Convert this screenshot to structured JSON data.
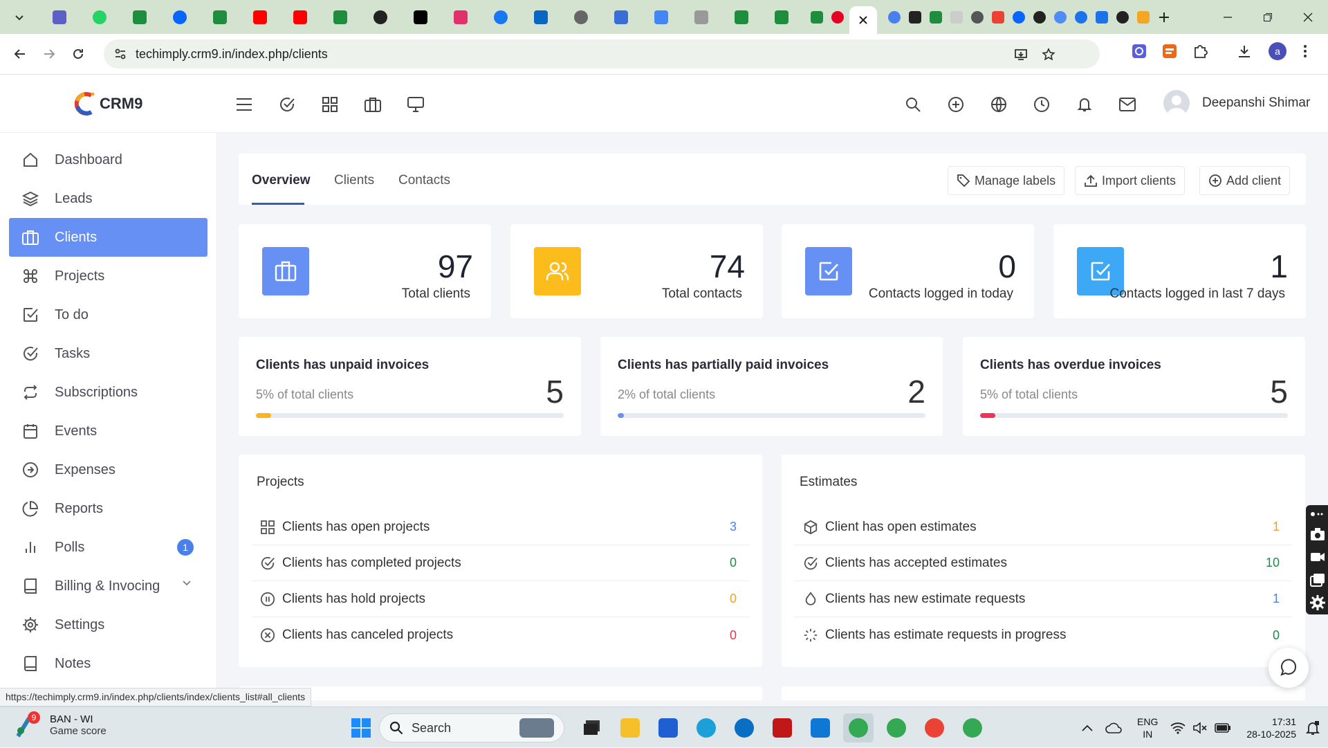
{
  "browser": {
    "url": "techimply.crm9.in/index.php/clients",
    "status_url": "https://techimply.crm9.in/index.php/clients/index/clients_list#all_clients",
    "profile_initial": "a"
  },
  "app": {
    "logo_text": "CRM9",
    "user_name": "Deepanshi Shimar"
  },
  "sidebar": {
    "items": [
      {
        "label": "Dashboard"
      },
      {
        "label": "Leads"
      },
      {
        "label": "Clients"
      },
      {
        "label": "Projects"
      },
      {
        "label": "To do"
      },
      {
        "label": "Tasks"
      },
      {
        "label": "Subscriptions"
      },
      {
        "label": "Events"
      },
      {
        "label": "Expenses"
      },
      {
        "label": "Reports"
      },
      {
        "label": "Polls",
        "badge": "1"
      },
      {
        "label": "Billing & Invocing"
      },
      {
        "label": "Settings"
      },
      {
        "label": "Notes"
      }
    ]
  },
  "page": {
    "tabs": [
      "Overview",
      "Clients",
      "Contacts"
    ],
    "actions": {
      "manage_labels": "Manage labels",
      "import_clients": "Import clients",
      "add_client": "Add client"
    }
  },
  "stats": [
    {
      "value": "97",
      "label": "Total clients",
      "color": "#6690f4"
    },
    {
      "value": "74",
      "label": "Total contacts",
      "color": "#fbbc1c"
    },
    {
      "value": "0",
      "label": "Contacts logged in today",
      "color": "#6690f4"
    },
    {
      "value": "1",
      "label": "Contacts logged in last 7 days",
      "color": "#3da8f5"
    }
  ],
  "invoices": [
    {
      "title": "Clients has unpaid invoices",
      "subtitle": "5% of total clients",
      "value": "5",
      "percent": 5,
      "color": "#fbb31e"
    },
    {
      "title": "Clients has partially paid invoices",
      "subtitle": "2% of total clients",
      "value": "2",
      "percent": 2,
      "color": "#6690f4"
    },
    {
      "title": "Clients has overdue invoices",
      "subtitle": "5% of total clients",
      "value": "5",
      "percent": 5,
      "color": "#f0325a"
    }
  ],
  "projects": {
    "title": "Projects",
    "rows": [
      {
        "label": "Clients has open projects",
        "value": "3",
        "color": "#4a80ee"
      },
      {
        "label": "Clients has completed projects",
        "value": "0",
        "color": "#1e8a4c"
      },
      {
        "label": "Clients has hold projects",
        "value": "0",
        "color": "#f0a020"
      },
      {
        "label": "Clients has canceled projects",
        "value": "0",
        "color": "#e8334a"
      }
    ]
  },
  "estimates": {
    "title": "Estimates",
    "rows": [
      {
        "label": "Client has open estimates",
        "value": "1",
        "color": "#f0a020"
      },
      {
        "label": "Clients has accepted estimates",
        "value": "10",
        "color": "#1e8a4c"
      },
      {
        "label": "Clients has new estimate requests",
        "value": "1",
        "color": "#4a80ee"
      },
      {
        "label": "Clients has estimate requests in progress",
        "value": "0",
        "color": "#1e8a4c"
      }
    ]
  },
  "taskbar": {
    "weather_badge": "9",
    "weather_title": "BAN - WI",
    "weather_sub": "Game score",
    "search": "Search",
    "lang1": "ENG",
    "lang2": "IN",
    "time": "17:31",
    "date": "28-10-2025"
  }
}
